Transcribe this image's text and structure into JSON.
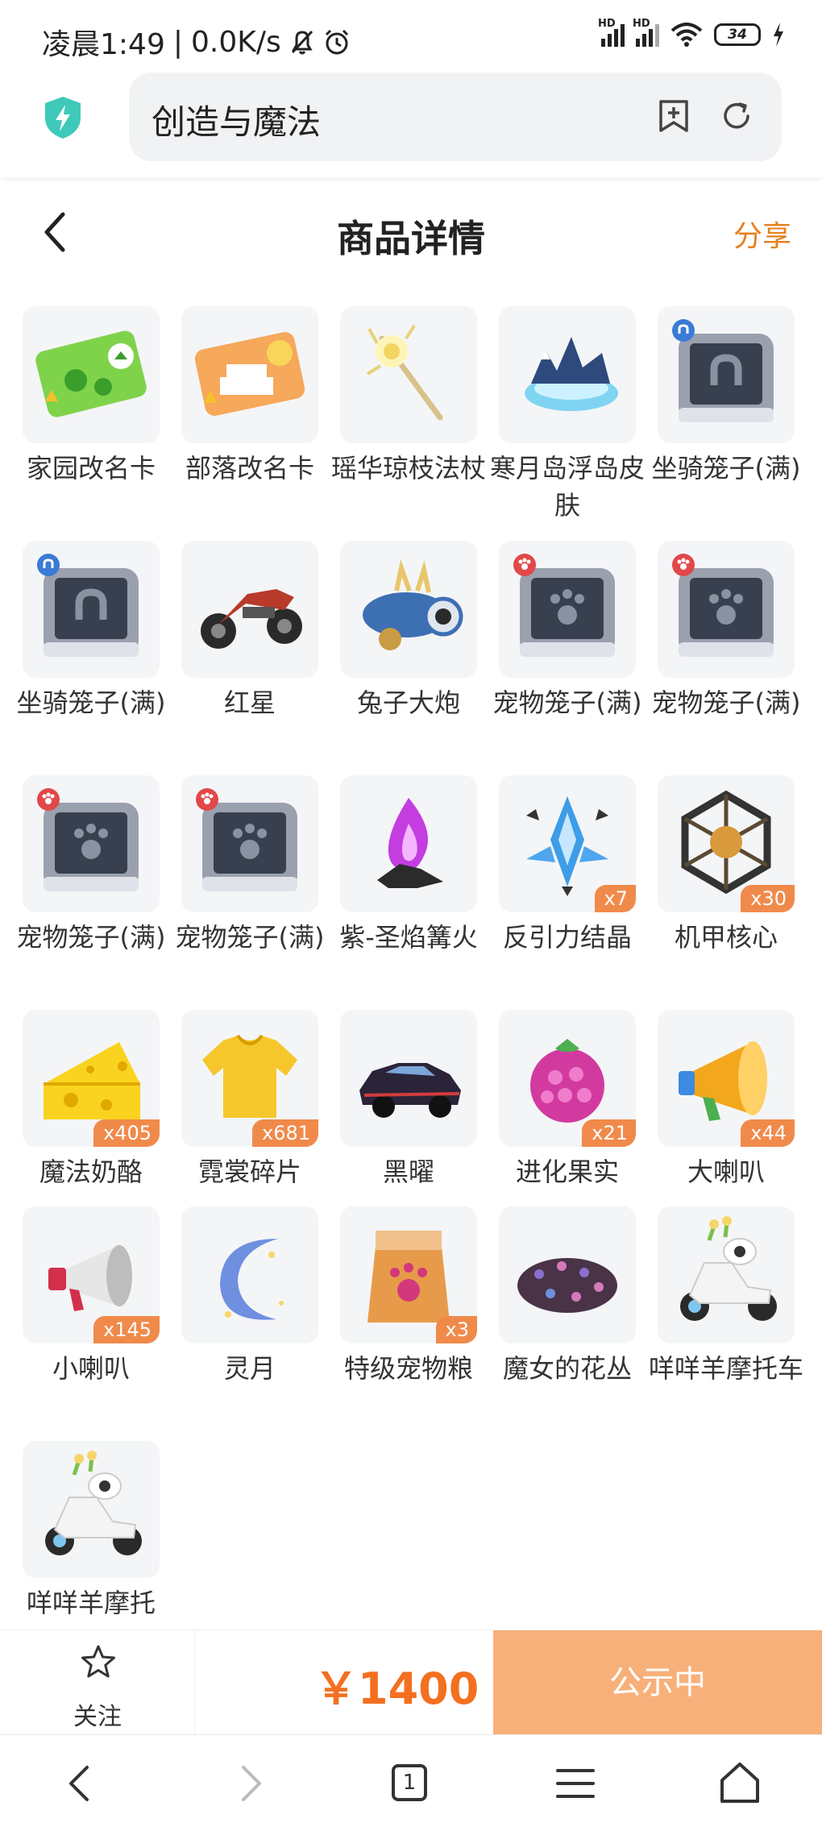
{
  "status_bar": {
    "time": "凌晨1:49",
    "speed": "0.0K/s",
    "battery": "34",
    "hd1": "HD",
    "hd2": "HD"
  },
  "browser": {
    "url_text": "创造与魔法",
    "shield_color": "#3ec9b9"
  },
  "header": {
    "title": "商品详情",
    "share_label": "分享",
    "accent_color": "#e7801f"
  },
  "items": [
    {
      "name": "家园改名卡",
      "qty": "",
      "icon": "green-clover-card-icon"
    },
    {
      "name": "部落改名卡",
      "qty": "",
      "icon": "orange-tribe-card-icon"
    },
    {
      "name": "瑶华琼枝法杖",
      "qty": "",
      "icon": "staff-icon"
    },
    {
      "name": "寒月岛浮岛皮肤",
      "qty": "",
      "icon": "floating-island-icon"
    },
    {
      "name": "坐骑笼子(满)",
      "qty": "",
      "icon": "mount-cage-icon"
    },
    {
      "name": "坐骑笼子(满)",
      "qty": "",
      "icon": "mount-cage-icon"
    },
    {
      "name": "红星",
      "qty": "",
      "icon": "motorcycle-icon"
    },
    {
      "name": "兔子大炮",
      "qty": "",
      "icon": "cannon-icon"
    },
    {
      "name": "宠物笼子(满)",
      "qty": "",
      "icon": "pet-cage-icon"
    },
    {
      "name": "宠物笼子(满)",
      "qty": "",
      "icon": "pet-cage-icon"
    },
    {
      "name": "宠物笼子(满)",
      "qty": "",
      "icon": "pet-cage-icon"
    },
    {
      "name": "宠物笼子(满)",
      "qty": "",
      "icon": "pet-cage-icon"
    },
    {
      "name": "紫-圣焰篝火",
      "qty": "",
      "icon": "purple-bonfire-icon"
    },
    {
      "name": "反引力结晶",
      "qty": "x7",
      "icon": "crystal-icon"
    },
    {
      "name": "机甲核心",
      "qty": "x30",
      "icon": "mech-core-icon"
    },
    {
      "name": "魔法奶酪",
      "qty": "x405",
      "icon": "cheese-icon"
    },
    {
      "name": "霓裳碎片",
      "qty": "x681",
      "icon": "shirt-icon"
    },
    {
      "name": "黑曜",
      "qty": "",
      "icon": "car-icon"
    },
    {
      "name": "进化果实",
      "qty": "x21",
      "icon": "berry-icon"
    },
    {
      "name": "大喇叭",
      "qty": "x44",
      "icon": "megaphone-icon"
    },
    {
      "name": "小喇叭",
      "qty": "x145",
      "icon": "small-megaphone-icon"
    },
    {
      "name": "灵月",
      "qty": "",
      "icon": "crescent-moon-icon"
    },
    {
      "name": "特级宠物粮",
      "qty": "x3",
      "icon": "pet-food-bag-icon"
    },
    {
      "name": "魔女的花丛",
      "qty": "",
      "icon": "flower-bush-icon"
    },
    {
      "name": "咩咩羊摩托车",
      "qty": "",
      "icon": "sheep-scooter-icon"
    },
    {
      "name": "咩咩羊摩托",
      "qty": "",
      "icon": "sheep-scooter-icon"
    }
  ],
  "footer": {
    "follow_label": "关注",
    "price": "￥1400",
    "status_label": "公示中",
    "price_color": "#f37021",
    "status_color": "#f8b07a"
  },
  "navbar": {
    "tab_count": "1"
  }
}
